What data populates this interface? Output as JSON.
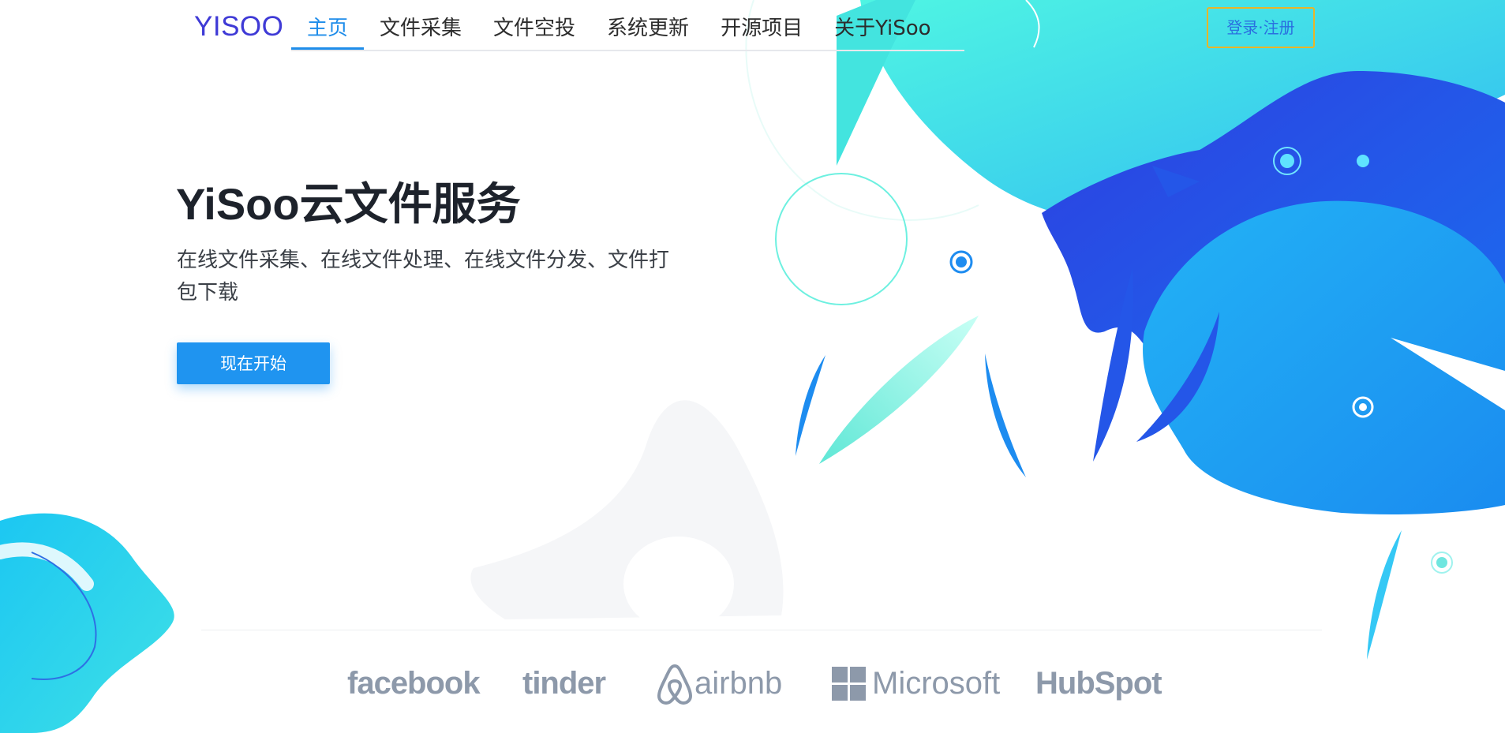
{
  "header": {
    "brand": "YISOO",
    "nav": [
      "主页",
      "文件采集",
      "文件空投",
      "系统更新",
      "开源项目",
      "关于YiSoo"
    ],
    "active_nav": "主页",
    "login_label": "登录·注册"
  },
  "hero": {
    "title": "YiSoo云文件服务",
    "subtitle": "在线文件采集、在线文件处理、在线文件分发、文件打包下载",
    "cta_label": "现在开始"
  },
  "partners": {
    "logos": [
      {
        "name": "facebook",
        "text": "facebook",
        "icon": "facebook-logo"
      },
      {
        "name": "tinder",
        "text": "tinder",
        "icon": "tinder-flame-logo"
      },
      {
        "name": "airbnb",
        "text": "airbnb",
        "icon": "airbnb-belo-logo"
      },
      {
        "name": "microsoft",
        "text": "Microsoft",
        "icon": "microsoft-grid-logo"
      },
      {
        "name": "hubspot",
        "text": "HubSpot",
        "icon": "hubspot-sprocket-logo"
      }
    ]
  },
  "colors": {
    "brand": "#3f3ad6",
    "accent": "#1f94f0",
    "nav_active": "#1f8dea",
    "login_border": "#e9b528",
    "logo_gray": "#8d99aa",
    "shape_cyan": "#3fe9e2",
    "shape_blue": "#2456e8"
  }
}
